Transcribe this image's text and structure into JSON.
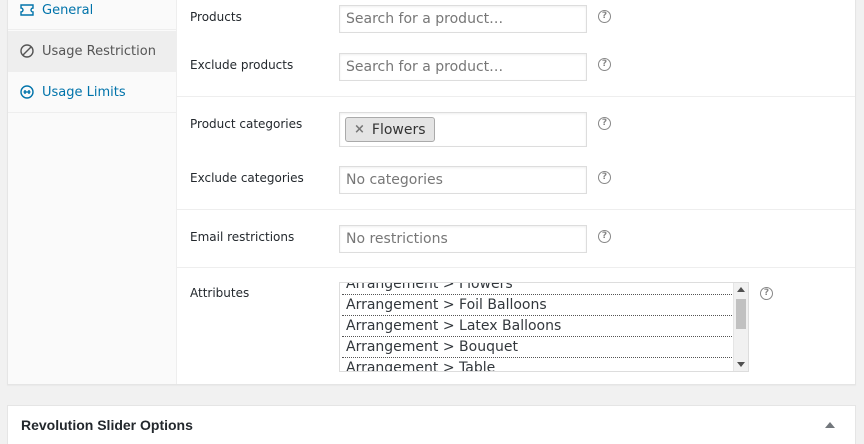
{
  "tabs": [
    {
      "label": "General",
      "icon": "ticket-icon",
      "active": false
    },
    {
      "label": "Usage Restriction",
      "icon": "ban-icon",
      "active": true
    },
    {
      "label": "Usage Limits",
      "icon": "limits-icon",
      "active": false
    }
  ],
  "fields": {
    "products": {
      "label": "Products",
      "placeholder": "Search for a product…"
    },
    "exclude_products": {
      "label": "Exclude products",
      "placeholder": "Search for a product…"
    },
    "product_categories": {
      "label": "Product categories",
      "chips": [
        "Flowers"
      ]
    },
    "exclude_categories": {
      "label": "Exclude categories",
      "placeholder": "No categories"
    },
    "email_restrictions": {
      "label": "Email restrictions",
      "placeholder": "No restrictions"
    },
    "attributes": {
      "label": "Attributes",
      "options": [
        "Arrangement > Flowers",
        "Arrangement > Foil Balloons",
        "Arrangement > Latex Balloons",
        "Arrangement > Bouquet",
        "Arrangement > Table"
      ]
    }
  },
  "help_glyph": "?",
  "remove_glyph": "×",
  "bottom_panel": {
    "title": "Revolution Slider Options"
  },
  "colors": {
    "link": "#0073aa",
    "active_tab_bg": "#eeeeee",
    "border": "#dddddd"
  }
}
